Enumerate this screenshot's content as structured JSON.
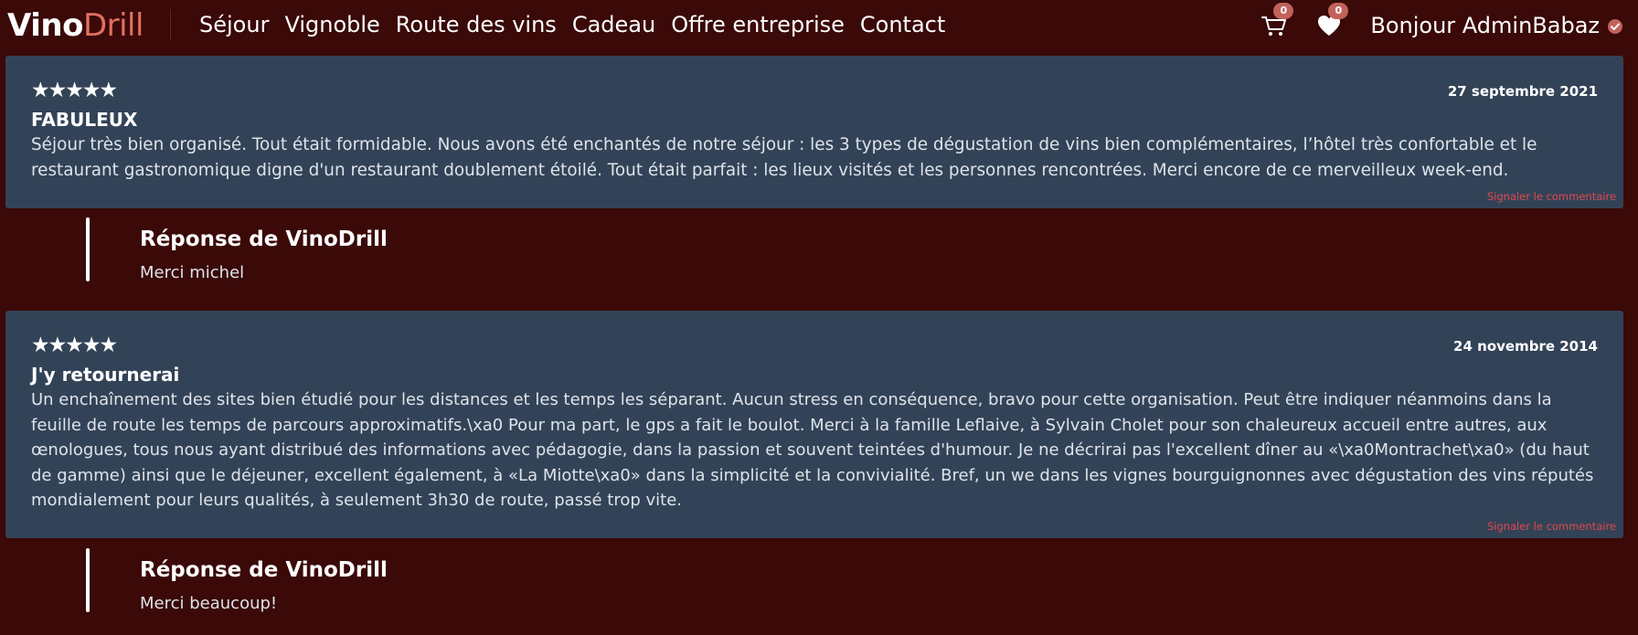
{
  "brand": {
    "part1": "Vino",
    "part2": "Drill"
  },
  "nav": {
    "links": [
      "Séjour",
      "Vignoble",
      "Route des vins",
      "Cadeau",
      "Offre entreprise",
      "Contact"
    ],
    "cart_count": "0",
    "favorites_count": "0",
    "greeting": "Bonjour AdminBabaz"
  },
  "colors": {
    "background": "#3a0908",
    "card": "#334357",
    "accent": "#e07060",
    "badge": "#c0625a",
    "report_link": "#e0474f"
  },
  "icons": [
    "cart-icon",
    "heart-icon",
    "verified-icon",
    "star-icon"
  ],
  "reviews": [
    {
      "rating": 5,
      "stars": "★★★★★",
      "date": "27 septembre 2021",
      "title": "FABULEUX",
      "body": "Séjour très bien organisé. Tout était formidable. Nous avons été enchantés de notre séjour : les 3 types de dégustation de vins bien complémentaires, l’hôtel très confortable et le restaurant gastronomique digne d'un restaurant doublement étoilé. Tout était parfait : les lieux visités et les personnes rencontrées. Merci encore de ce merveilleux week-end.",
      "report_label": "Signaler le commentaire",
      "reply": {
        "title": "Réponse de VinoDrill",
        "text": "Merci michel"
      }
    },
    {
      "rating": 5,
      "stars": "★★★★★",
      "date": "24 novembre 2014",
      "title": "J'y retournerai",
      "body": "Un enchaînement des sites bien étudié pour les distances et les temps les séparant. Aucun stress en conséquence, bravo pour cette organisation. Peut être indiquer néanmoins dans la feuille de route les temps de parcours approximatifs.\\xa0 Pour ma part, le gps a fait le boulot. Merci à la famille Leflaive, à Sylvain Cholet pour son chaleureux accueil entre autres, aux œnologues, tous nous ayant distribué des informations avec pédagogie, dans la passion et souvent teintées d'humour. Je ne décrirai pas l'excellent dîner au «\\xa0Montrachet\\xa0» (du haut de gamme) ainsi que le déjeuner, excellent également, à «La Miotte\\xa0» dans la simplicité et la convivialité. Bref, un we dans les vignes bourguignonnes avec dégustation des vins réputés mondialement pour leurs qualités, à seulement 3h30 de route, passé trop vite.",
      "report_label": "Signaler le commentaire",
      "reply": {
        "title": "Réponse de VinoDrill",
        "text": "Merci beaucoup!"
      }
    }
  ]
}
